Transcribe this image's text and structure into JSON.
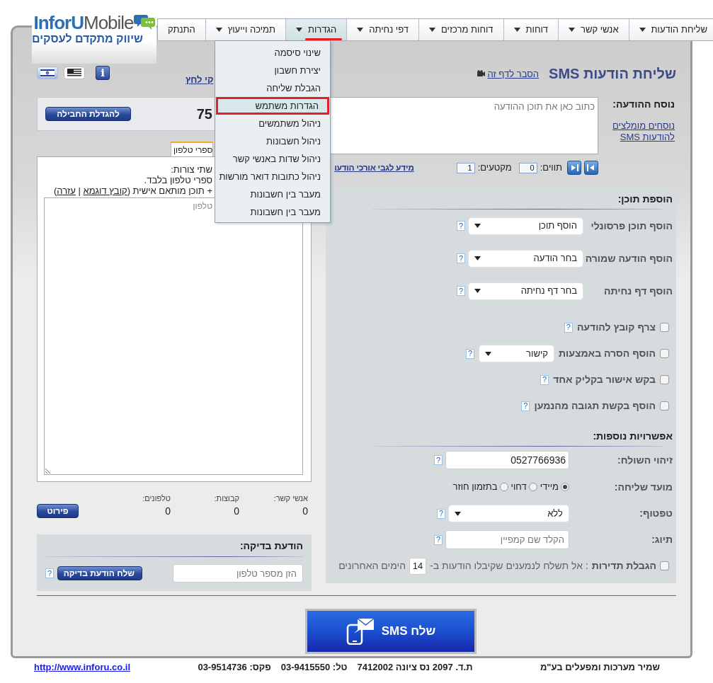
{
  "logo": {
    "brand": {
      "first": "InforU",
      "second": "Mobile"
    },
    "tagline": "שיווק מתקדם לעסקים"
  },
  "nav": [
    {
      "label": "שליחת הודעות",
      "dropdown": true,
      "selected": false
    },
    {
      "label": "אנשי קשר",
      "dropdown": true,
      "selected": false
    },
    {
      "label": "דוחות",
      "dropdown": true,
      "selected": false
    },
    {
      "label": "דוחות מרכזים",
      "dropdown": true,
      "selected": false
    },
    {
      "label": "דפי נחיתה",
      "dropdown": true,
      "selected": false
    },
    {
      "label": "הגדרות",
      "dropdown": true,
      "selected": true
    },
    {
      "label": "תמיכה וייעוץ",
      "dropdown": true,
      "selected": false
    },
    {
      "label": "התנתק",
      "dropdown": false,
      "selected": false
    }
  ],
  "menu": [
    {
      "label": "שינוי סיסמה",
      "selected": false
    },
    {
      "label": "יצירת חשבון",
      "selected": false
    },
    {
      "label": "הגבלת שליחה",
      "selected": false
    },
    {
      "label": "הגדרות משתמש",
      "selected": true
    },
    {
      "label": "ניהול משתמשים",
      "selected": false
    },
    {
      "label": "ניהול חשבונות",
      "selected": false
    },
    {
      "label": "ניהול שדות באנשי קשר",
      "selected": false
    },
    {
      "label": "ניהול כתובות דואר מורשות",
      "selected": false
    },
    {
      "label": "מעבר בין חשבונות",
      "selected": false
    },
    {
      "label": "מעבר בין חשבונות",
      "selected": false
    }
  ],
  "header": {
    "title": "שליחת הודעות SMS",
    "help_link": "הסבר לדף זה",
    "languages": [
      {
        "kind": "english",
        "selected": false
      },
      {
        "kind": "hebrew",
        "selected": true
      }
    ],
    "info": "i",
    "link": "קי לחץ"
  },
  "credit": {
    "value": "75",
    "button": "להגדלת החבילה"
  },
  "message": {
    "label": "נוסח ההודעה:",
    "templates_link": "נוסחים מומלצים להודעות SMS",
    "placeholder": "כתוב כאן את תוכן ההודעה",
    "chars_label": "תווים:",
    "chars": "0",
    "segments_label": "מקטעים:",
    "segments": "1",
    "length_link": "מידע לגבי אורכי הודעו"
  },
  "recipients": {
    "tab": "ספרי טלפון",
    "lines": [
      "שתי צורות:",
      "ספרי טלפון בלבד."
    ],
    "note": {
      "text": "+ תוכן מותאם אישית (",
      "sample_link": "קובץ דוגמא",
      "separator": " | ",
      "help_link": "עזרה",
      "close": ")"
    },
    "placeholder": "טלפון",
    "stats": [
      {
        "label": "אנשי קשר:",
        "value": "0"
      },
      {
        "label": "קבוצות:",
        "value": "0"
      },
      {
        "label": "טלפונים:",
        "value": "0"
      }
    ],
    "details_button": "פירוט"
  },
  "test_message": {
    "title": "הודעת בדיקה:",
    "placeholder": "הזן מספר טלפון",
    "button": "שלח הודעת בדיקה",
    "help": "?"
  },
  "content": {
    "title": "הוספת תוכן:",
    "rows": [
      {
        "kind": "select",
        "label": "הוסף תוכן פרסונלי",
        "value": "הוסף תוכן",
        "help": "?"
      },
      {
        "kind": "select",
        "label": "הוסף הודעה שמורה",
        "value": "בחר הודעה",
        "help": "?"
      },
      {
        "kind": "select",
        "label": "הוסף דף נחיתה",
        "value": "בחר דף נחיתה",
        "help": "?"
      },
      {
        "kind": "checkbox",
        "label": "צרף קובץ להודעה",
        "checked": false,
        "help": "?"
      },
      {
        "kind": "checkbox_select",
        "label": "הוסף הסרה באמצעות",
        "value": "קישור",
        "checked": false,
        "help": "?"
      },
      {
        "kind": "checkbox",
        "label": "בקש אישור בקליק אחד",
        "checked": false,
        "help": "?"
      },
      {
        "kind": "checkbox",
        "label": "הוסף בקשת תגובה מהנמען",
        "checked": false,
        "help": "?"
      }
    ]
  },
  "options": {
    "title": "אפשרויות נוספות:",
    "sender": {
      "label": "זיהוי השולח:",
      "value": "0527766936",
      "help": "?"
    },
    "timing": {
      "label": "מועד שליחה:",
      "choices": [
        {
          "label": "מיידי",
          "selected": true
        },
        {
          "label": "דחוי",
          "selected": false
        },
        {
          "label": "בתזמון חוזר",
          "selected": false
        }
      ]
    },
    "drip": {
      "label": "טפטוף:",
      "value": "ללא",
      "help": "?"
    },
    "tag": {
      "label": "תיוג:",
      "placeholder": "הקלד שם קמפיין",
      "help": "?"
    },
    "limit": {
      "checked": false,
      "label": "הגבלת תדירות",
      "text": ": אל תשלח לנמענים שקיבלו הודעות ב-",
      "days": "14",
      "suffix": "הימים האחרונים"
    }
  },
  "send_button": "שלח SMS",
  "footer": {
    "company": "שמיר מערכות ומפעלים בע\"מ",
    "address": "ת.ד. 2097 נס ציונה 7412002",
    "phone": "טל: 03-9415550",
    "fax": "פקס: 03-9514736",
    "url": "http://www.inforu.co.il"
  }
}
